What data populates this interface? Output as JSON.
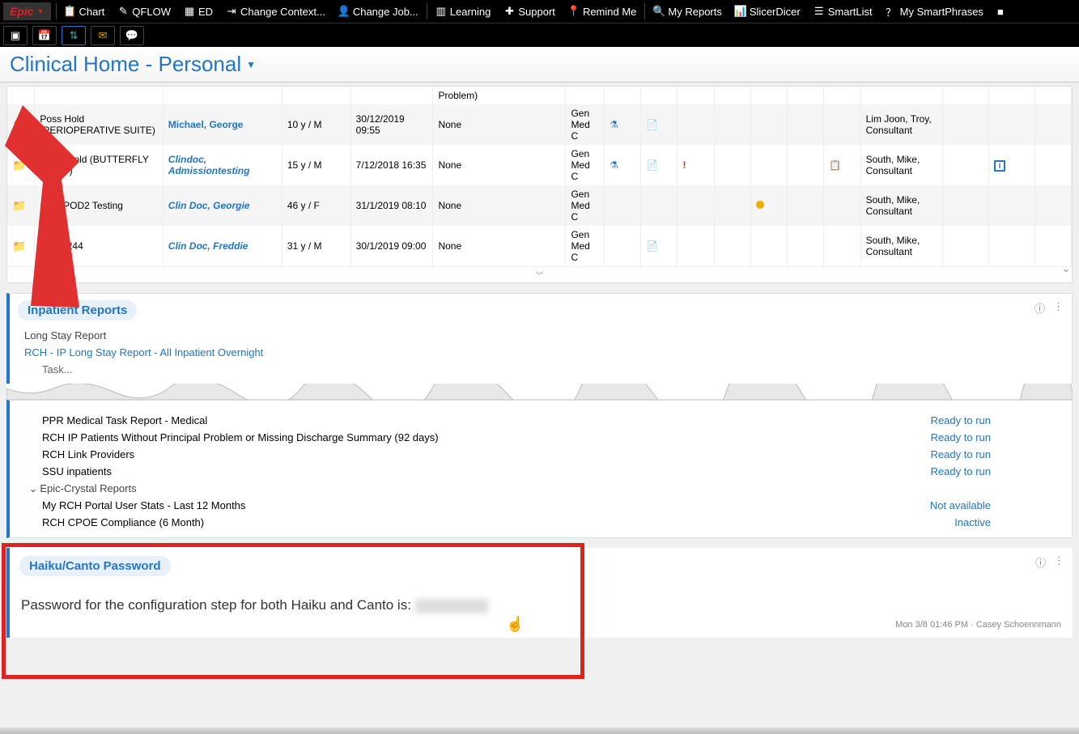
{
  "topbar": {
    "epic": "Epic",
    "items": [
      {
        "label": "Chart",
        "icon": "chart"
      },
      {
        "label": "QFLOW",
        "icon": "pencil"
      },
      {
        "label": "ED",
        "icon": "grid"
      },
      {
        "label": "Change Context...",
        "icon": "exit"
      },
      {
        "label": "Change Job...",
        "icon": "person"
      },
      {
        "label": "Learning",
        "icon": "bars"
      },
      {
        "label": "Support",
        "icon": "plus"
      },
      {
        "label": "Remind Me",
        "icon": "pin"
      },
      {
        "label": "My Reports",
        "icon": "search"
      },
      {
        "label": "SlicerDicer",
        "icon": "slice"
      },
      {
        "label": "SmartList",
        "icon": "list"
      },
      {
        "label": "My SmartPhrases",
        "icon": "help"
      }
    ]
  },
  "page": {
    "title": "Clinical Home - Personal"
  },
  "table": {
    "header_fragment": "Problem)",
    "rows": [
      {
        "loc": "Poss Hold (PERIOPERATIVE SUITE)",
        "name": "Michael, George",
        "name_style": "link",
        "age": "10 y / M",
        "dt": "30/12/2019 09:55",
        "none": "None",
        "svc": "Gen Med C",
        "flask": true,
        "note": true,
        "alert": false,
        "clip": false,
        "dot": false,
        "prov": "Lim Joon, Troy, Consultant",
        "info": false
      },
      {
        "loc": "Posel Hold (BUTTERFLY WARD)",
        "name": "Clindoc, Admissiontesting",
        "name_style": "link-italic",
        "age": "15 y / M",
        "dt": "7/12/2018 16:35",
        "none": "None",
        "svc": "Gen Med C",
        "flask": true,
        "note": true,
        "alert": true,
        "clip": true,
        "dot": false,
        "prov": "South, Mike, Consultant",
        "info": true
      },
      {
        "loc": "Surg POD2 Testing",
        "name": "Clin Doc, Georgie",
        "name_style": "link-italic",
        "age": "46 y / F",
        "dt": "31/1/2019 08:10",
        "none": "None",
        "svc": "Gen Med C",
        "flask": false,
        "note": false,
        "alert": false,
        "clip": false,
        "dot": true,
        "prov": "South, Mike, Consultant",
        "info": false
      },
      {
        "loc": "SGlid-244",
        "name": "Clin Doc, Freddie",
        "name_style": "link-italic",
        "age": "31 y / M",
        "dt": "30/1/2019 09:00",
        "none": "None",
        "svc": "Gen Med C",
        "flask": false,
        "note": true,
        "alert": false,
        "clip": false,
        "dot": false,
        "prov": "South, Mike, Consultant",
        "info": false
      }
    ]
  },
  "reports_panel": {
    "title": "Inpatient Reports",
    "subtitle": "Long Stay Report",
    "link": "RCH - IP Long Stay Report - All Inpatient Overnight"
  },
  "reports_list": {
    "items": [
      {
        "label": "PPR Medical Task Report - Medical",
        "status": "Ready to run"
      },
      {
        "label": "RCH IP Patients Without Principal Problem or Missing Discharge Summary (92 days)",
        "status": "Ready to run"
      },
      {
        "label": "RCH Link Providers",
        "status": "Ready to run"
      },
      {
        "label": "SSU inpatients",
        "status": "Ready to run"
      }
    ],
    "group": "Epic-Crystal Reports",
    "group_items": [
      {
        "label": "My RCH Portal User Stats - Last 12 Months",
        "status": "Not available"
      },
      {
        "label": "RCH CPOE Compliance (6 Month)",
        "status": "Inactive"
      }
    ]
  },
  "haiku": {
    "title": "Haiku/Canto Password",
    "text": "Password for the configuration step for both Haiku and Canto is:",
    "footer": "Mon 3/8 01:46 PM · Casey Schoennmann"
  }
}
